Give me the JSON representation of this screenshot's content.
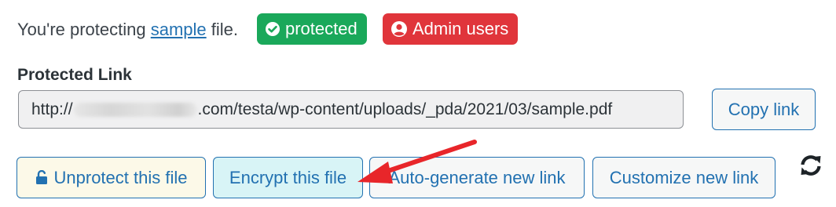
{
  "status": {
    "prefix": "You're protecting ",
    "file_link": "sample",
    "suffix": " file.",
    "badge_protected": "protected",
    "badge_admin": "Admin users"
  },
  "protected_link": {
    "label": "Protected Link",
    "url_prefix": "http://",
    "url_suffix": ".com/testa/wp-content/uploads/_pda/2021/03/sample.pdf",
    "copy_button": "Copy link"
  },
  "actions": {
    "unprotect": "Unprotect this file",
    "encrypt": "Encrypt this file",
    "auto_generate": "Auto-generate new link",
    "customize": "Customize new link"
  },
  "icons": {
    "protected_badge": "check-circle-icon",
    "admin_badge": "user-circle-icon",
    "unprotect": "unlock-icon",
    "refresh": "refresh-icon",
    "annotation": "red-arrow"
  },
  "colors": {
    "accent": "#2271b1",
    "protected": "#1aa85a",
    "admin": "#e0353b",
    "arrow": "#e8262a"
  }
}
